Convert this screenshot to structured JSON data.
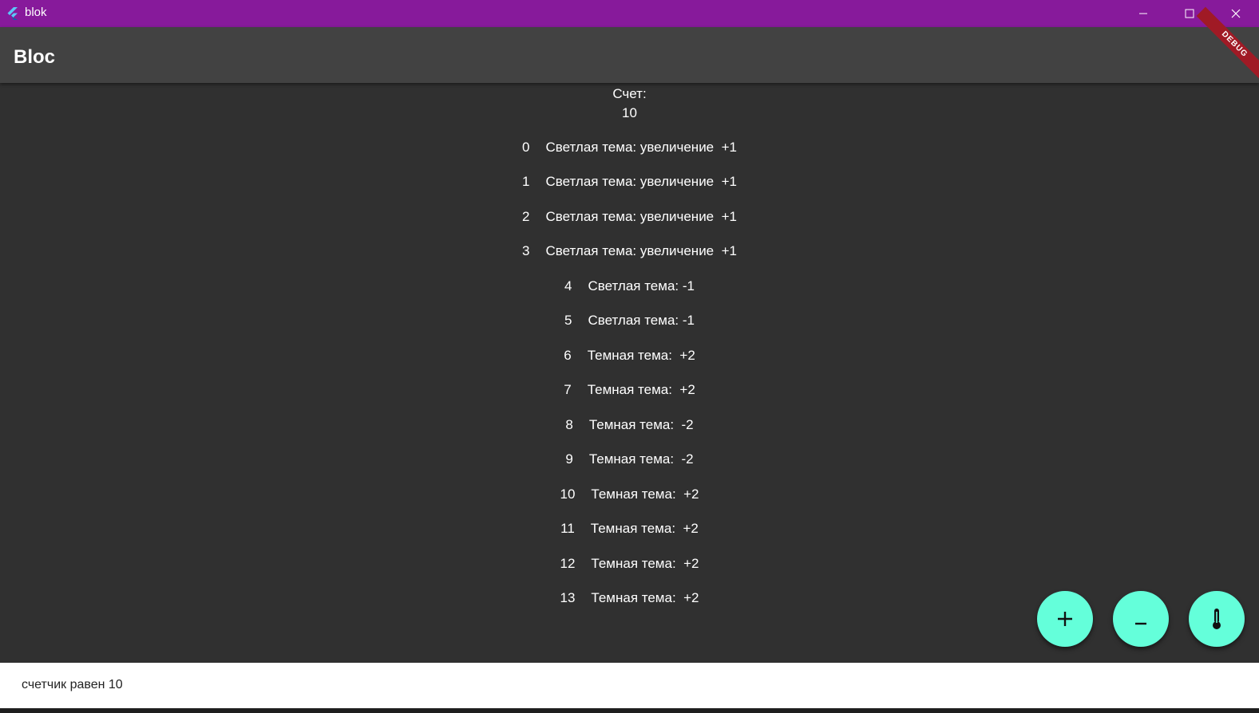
{
  "window": {
    "title": "blok",
    "minimize_icon": "minimize-icon",
    "maximize_icon": "maximize-icon",
    "close_icon": "close-icon"
  },
  "appbar": {
    "title": "Bloc",
    "debug_banner": "DEBUG"
  },
  "counter": {
    "label": "Счет:",
    "value": "10"
  },
  "history": [
    {
      "index": "0",
      "text": "Светлая тема: увеличение  +1"
    },
    {
      "index": "1",
      "text": "Светлая тема: увеличение  +1"
    },
    {
      "index": "2",
      "text": "Светлая тема: увеличение  +1"
    },
    {
      "index": "3",
      "text": "Светлая тема: увеличение  +1"
    },
    {
      "index": "4",
      "text": "Светлая тема: -1"
    },
    {
      "index": "5",
      "text": "Светлая тема: -1"
    },
    {
      "index": "6",
      "text": "Темная тема:  +2"
    },
    {
      "index": "7",
      "text": "Темная тема:  +2"
    },
    {
      "index": "8",
      "text": "Темная тема:  -2"
    },
    {
      "index": "9",
      "text": "Темная тема:  -2"
    },
    {
      "index": "10",
      "text": "Темная тема:  +2"
    },
    {
      "index": "11",
      "text": "Темная тема:  +2"
    },
    {
      "index": "12",
      "text": "Темная тема:  +2"
    },
    {
      "index": "13",
      "text": "Темная тема:  +2"
    }
  ],
  "fabs": {
    "add_icon": "plus-icon",
    "remove_icon": "minus-icon",
    "theme_icon": "thermometer-icon"
  },
  "snackbar": {
    "text": "счетчик равен 10"
  },
  "colors": {
    "titlebar": "#871a9b",
    "appbar": "#424242",
    "background": "#303030",
    "fab": "#64ffda",
    "debug_banner": "#a01a25"
  }
}
